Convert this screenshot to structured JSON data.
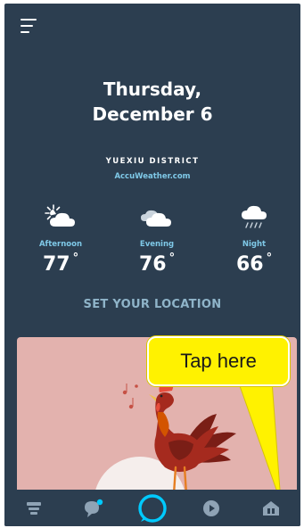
{
  "header": {
    "menu_icon": "hamburger-menu-icon",
    "date_line1": "Thursday,",
    "date_line2": "December 6"
  },
  "weather": {
    "district": "YUEXIU DISTRICT",
    "source": "AccuWeather.com",
    "periods": [
      {
        "label": "Afternoon",
        "temp": "77",
        "unit": "°",
        "icon": "partly-sunny-icon"
      },
      {
        "label": "Evening",
        "temp": "76",
        "unit": "°",
        "icon": "cloudy-icon"
      },
      {
        "label": "Night",
        "temp": "66",
        "unit": "°",
        "icon": "rain-cloud-icon"
      }
    ],
    "set_location": "SET YOUR LOCATION"
  },
  "card": {
    "image": "rooster-crowing-illustration"
  },
  "callout": {
    "text": "Tap here",
    "color": "#fff200"
  },
  "bottom_nav": {
    "items": [
      {
        "name": "home",
        "icon": "home-list-icon"
      },
      {
        "name": "communicate",
        "icon": "chat-bubble-icon"
      },
      {
        "name": "alexa",
        "icon": "alexa-ring-icon"
      },
      {
        "name": "play",
        "icon": "play-icon"
      },
      {
        "name": "devices",
        "icon": "smart-home-icon"
      }
    ],
    "accent_color": "#00caff"
  },
  "colors": {
    "background": "#2c3e50",
    "accent": "#7fc9e8",
    "card": "#e3b2ae"
  }
}
